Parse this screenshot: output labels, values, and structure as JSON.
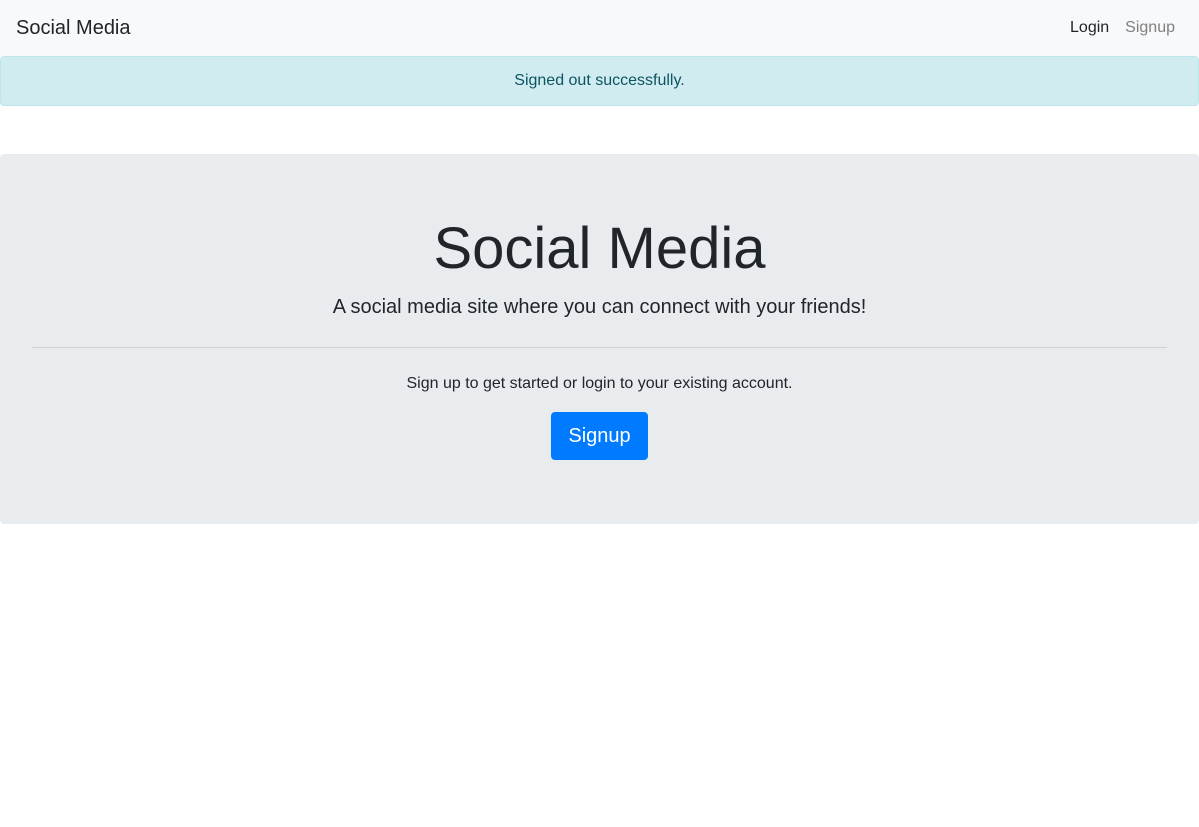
{
  "navbar": {
    "brand": "Social Media",
    "links": [
      {
        "label": "Login"
      },
      {
        "label": "Signup"
      }
    ]
  },
  "alert": {
    "message": "Signed out successfully."
  },
  "hero": {
    "title": "Social Media",
    "lead": "A social media site where you can connect with your friends!",
    "subtext": "Sign up to get started or login to your existing account.",
    "button_label": "Signup"
  },
  "colors": {
    "navbar_bg": "#f8f9fa",
    "alert_bg": "#d1ecf1",
    "alert_text": "#0c5460",
    "hero_bg": "#e9ecef",
    "primary": "#007bff"
  }
}
